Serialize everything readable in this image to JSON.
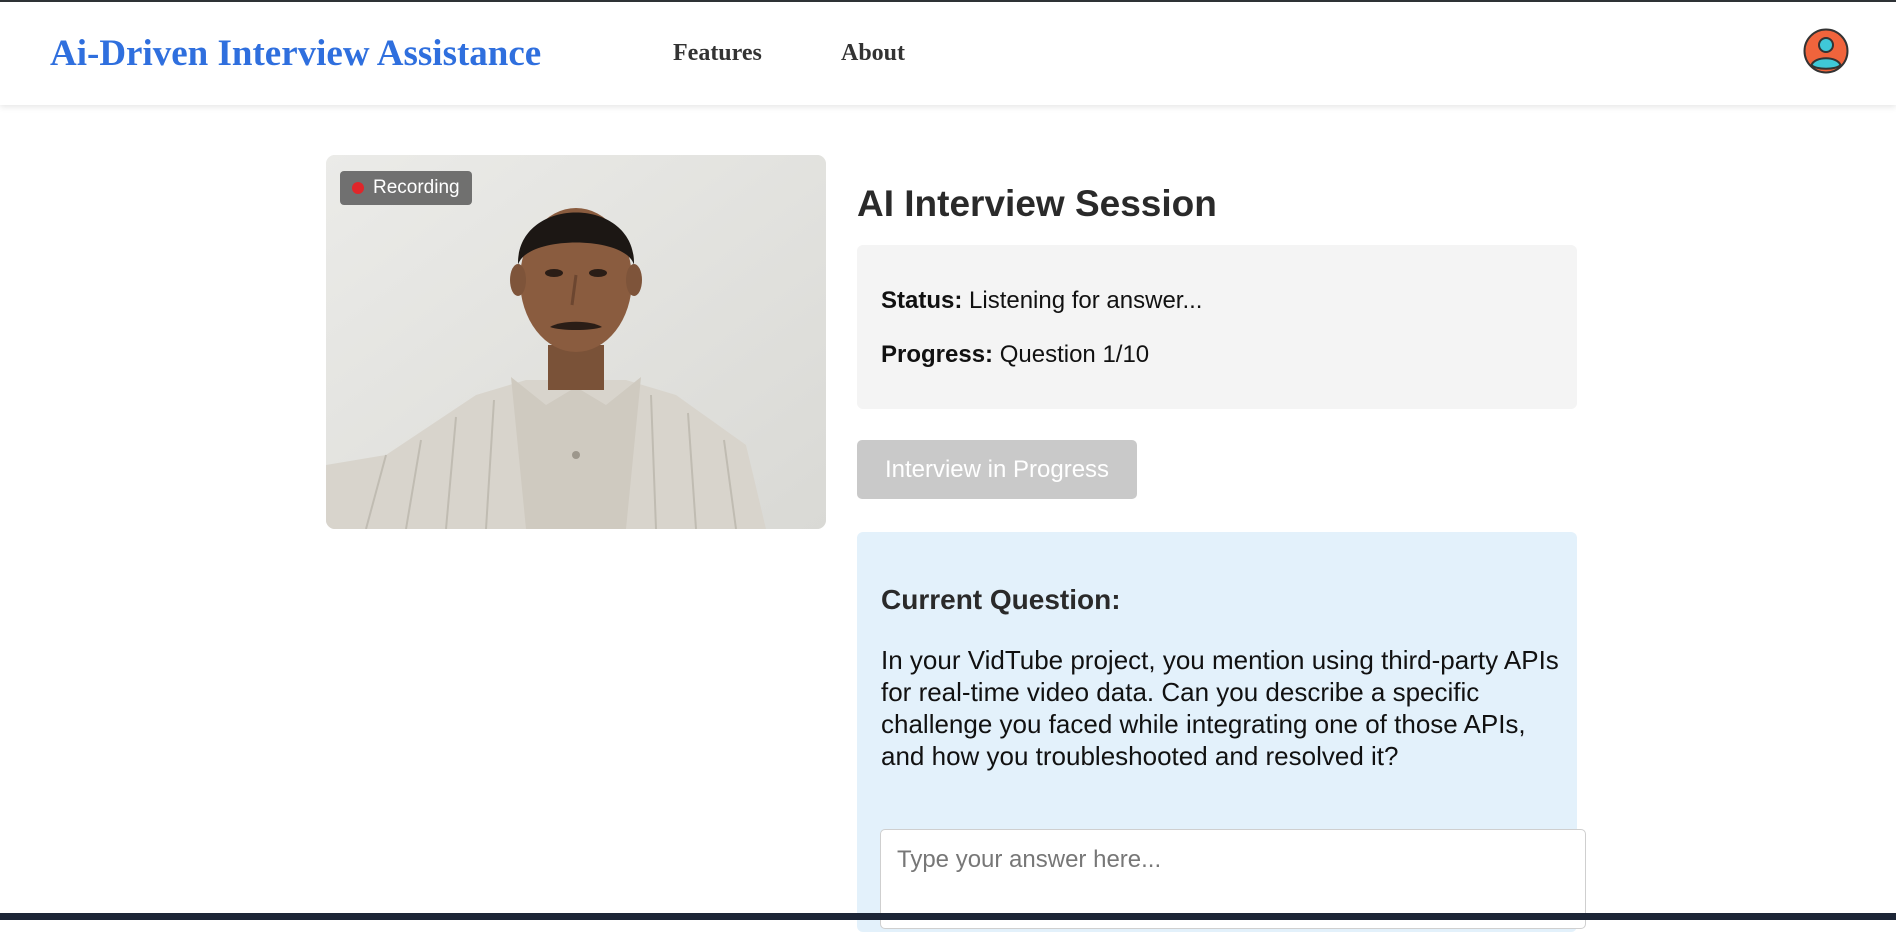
{
  "app": {
    "brand": "Ai-Driven Interview Assistance",
    "colors": {
      "brand": "#2f6fde",
      "recording": "#e0262a",
      "question_bg": "#e3f1fb",
      "status_bg": "#f4f4f4"
    }
  },
  "nav": {
    "items": [
      {
        "label": "Features"
      },
      {
        "label": "About"
      }
    ],
    "avatar_icon": "user-avatar-icon"
  },
  "video": {
    "recording_label": "Recording",
    "recording_icon": "red-dot"
  },
  "session": {
    "title": "AI Interview Session",
    "status_label": "Status:",
    "status_value": "Listening for answer...",
    "progress_label": "Progress:",
    "progress_value": "Question 1/10",
    "button_label": "Interview in Progress"
  },
  "question": {
    "heading": "Current Question:",
    "text": "In your VidTube project, you mention using third-party APIs for real-time video data. Can you describe a specific challenge you faced while integrating one of those APIs, and how you troubleshooted and resolved it?",
    "answer_placeholder": "Type your answer here...",
    "answer_value": ""
  }
}
